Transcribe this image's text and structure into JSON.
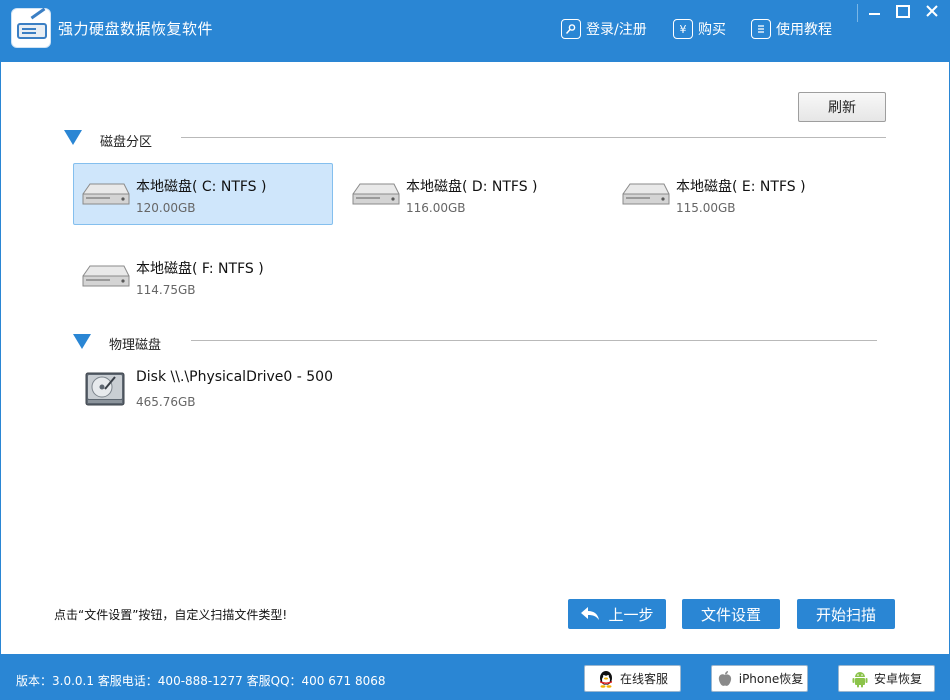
{
  "app": {
    "title": "强力硬盘数据恢复软件"
  },
  "header": {
    "links": [
      {
        "label": "登录/注册",
        "icon": "login-key-icon"
      },
      {
        "label": "购买",
        "icon": "yen-icon"
      },
      {
        "label": "使用教程",
        "icon": "tutorial-doc-icon"
      }
    ]
  },
  "toolbar": {
    "refresh_label": "刷新"
  },
  "sections": {
    "partitions": {
      "label": "磁盘分区"
    },
    "physical": {
      "label": "物理磁盘"
    }
  },
  "partitions": [
    {
      "name": "本地磁盘( C: NTFS )",
      "size": "120.00GB",
      "selected": true
    },
    {
      "name": "本地磁盘( D: NTFS )",
      "size": "116.00GB",
      "selected": false
    },
    {
      "name": "本地磁盘( E: NTFS )",
      "size": "115.00GB",
      "selected": false
    },
    {
      "name": "本地磁盘( F: NTFS )",
      "size": "114.75GB",
      "selected": false
    }
  ],
  "physical_disks": [
    {
      "name": "Disk \\\\.\\PhysicalDrive0 - 500",
      "size": "465.76GB"
    }
  ],
  "hint": "点击“文件设置”按钮，自定义扫描文件类型!",
  "actions": {
    "prev": "上一步",
    "settings": "文件设置",
    "scan": "开始扫描"
  },
  "footer": {
    "info": "版本：3.0.0.1 客服电话：400-888-1277   客服QQ：400 671 8068",
    "buttons": {
      "service": "在线客服",
      "iphone": "iPhone恢复",
      "android": "安卓恢复"
    }
  },
  "colors": {
    "accent": "#2a86d4",
    "selected_bg": "#cfe6fb",
    "selected_border": "#84bfee"
  }
}
